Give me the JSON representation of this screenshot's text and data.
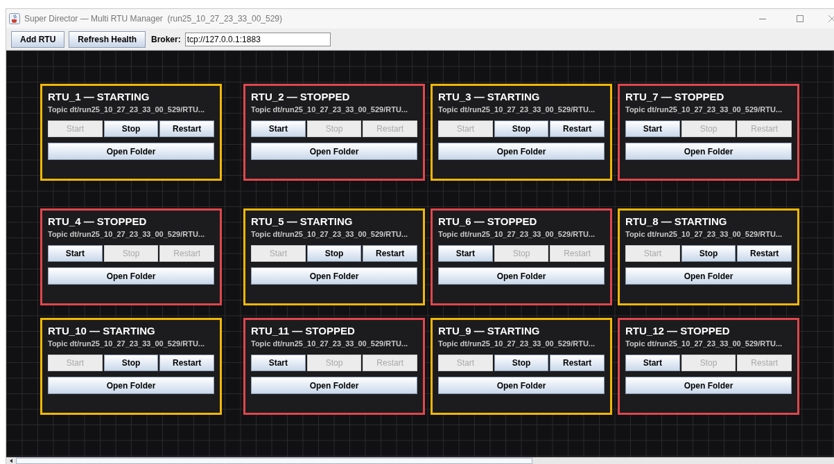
{
  "window": {
    "title": "Super Director — Multi RTU Manager  (run25_10_27_23_33_00_529)"
  },
  "toolbar": {
    "buttons": [
      "Add RTU",
      "Refresh Health"
    ],
    "broker_label": "Broker:",
    "broker_value": "tcp://127.0.0.1:1883"
  },
  "cards": [
    {
      "title": "RTU_1 — STARTING",
      "color": "#f2b705",
      "topic": "Topic dt/run25_10_27_23_33_00_529/RTU...",
      "buttons": [
        {
          "label": "Start",
          "disabled": true
        },
        {
          "label": "Stop",
          "disabled": false
        },
        {
          "label": "Restart",
          "disabled": false
        }
      ],
      "folder": "Open Folder"
    },
    {
      "title": "RTU_2 — STOPPED",
      "color": "#e0474c",
      "topic": "Topic dt/run25_10_27_23_33_00_529/RTU...",
      "buttons": [
        {
          "label": "Start",
          "disabled": false
        },
        {
          "label": "Stop",
          "disabled": true
        },
        {
          "label": "Restart",
          "disabled": true
        }
      ],
      "folder": "Open Folder"
    },
    {
      "title": "RTU_3 — STARTING",
      "color": "#f2b705",
      "topic": "Topic dt/run25_10_27_23_33_00_529/RTU...",
      "buttons": [
        {
          "label": "Start",
          "disabled": true
        },
        {
          "label": "Stop",
          "disabled": false
        },
        {
          "label": "Restart",
          "disabled": false
        }
      ],
      "folder": "Open Folder"
    },
    {
      "title": "RTU_7 — STOPPED",
      "color": "#e0474c",
      "topic": "Topic dt/run25_10_27_23_33_00_529/RTU...",
      "buttons": [
        {
          "label": "Start",
          "disabled": false
        },
        {
          "label": "Stop",
          "disabled": true
        },
        {
          "label": "Restart",
          "disabled": true
        }
      ],
      "folder": "Open Folder"
    },
    {
      "title": "RTU_4 — STOPPED",
      "color": "#e0474c",
      "topic": "Topic dt/run25_10_27_23_33_00_529/RTU...",
      "buttons": [
        {
          "label": "Start",
          "disabled": false
        },
        {
          "label": "Stop",
          "disabled": true
        },
        {
          "label": "Restart",
          "disabled": true
        }
      ],
      "folder": "Open Folder"
    },
    {
      "title": "RTU_5 — STARTING",
      "color": "#f2b705",
      "topic": "Topic dt/run25_10_27_23_33_00_529/RTU...",
      "buttons": [
        {
          "label": "Start",
          "disabled": true
        },
        {
          "label": "Stop",
          "disabled": false
        },
        {
          "label": "Restart",
          "disabled": false
        }
      ],
      "folder": "Open Folder"
    },
    {
      "title": "RTU_6 — STOPPED",
      "color": "#e0474c",
      "topic": "Topic dt/run25_10_27_23_33_00_529/RTU...",
      "buttons": [
        {
          "label": "Start",
          "disabled": false
        },
        {
          "label": "Stop",
          "disabled": true
        },
        {
          "label": "Restart",
          "disabled": true
        }
      ],
      "folder": "Open Folder"
    },
    {
      "title": "RTU_8 — STARTING",
      "color": "#f2b705",
      "topic": "Topic dt/run25_10_27_23_33_00_529/RTU...",
      "buttons": [
        {
          "label": "Start",
          "disabled": true
        },
        {
          "label": "Stop",
          "disabled": false
        },
        {
          "label": "Restart",
          "disabled": false
        }
      ],
      "folder": "Open Folder"
    },
    {
      "title": "RTU_10 — STARTING",
      "color": "#f2b705",
      "topic": "Topic dt/run25_10_27_23_33_00_529/RTU...",
      "buttons": [
        {
          "label": "Start",
          "disabled": true
        },
        {
          "label": "Stop",
          "disabled": false
        },
        {
          "label": "Restart",
          "disabled": false
        }
      ],
      "folder": "Open Folder"
    },
    {
      "title": "RTU_11 — STOPPED",
      "color": "#e0474c",
      "topic": "Topic dt/run25_10_27_23_33_00_529/RTU...",
      "buttons": [
        {
          "label": "Start",
          "disabled": false
        },
        {
          "label": "Stop",
          "disabled": true
        },
        {
          "label": "Restart",
          "disabled": true
        }
      ],
      "folder": "Open Folder"
    },
    {
      "title": "RTU_9 — STARTING",
      "color": "#f2b705",
      "topic": "Topic dt/run25_10_27_23_33_00_529/RTU...",
      "buttons": [
        {
          "label": "Start",
          "disabled": true
        },
        {
          "label": "Stop",
          "disabled": false
        },
        {
          "label": "Restart",
          "disabled": false
        }
      ],
      "folder": "Open Folder"
    },
    {
      "title": "RTU_12 — STOPPED",
      "color": "#e0474c",
      "topic": "Topic dt/run25_10_27_23_33_00_529/RTU...",
      "buttons": [
        {
          "label": "Start",
          "disabled": false
        },
        {
          "label": "Stop",
          "disabled": true
        },
        {
          "label": "Restart",
          "disabled": true
        }
      ],
      "folder": "Open Folder"
    }
  ]
}
